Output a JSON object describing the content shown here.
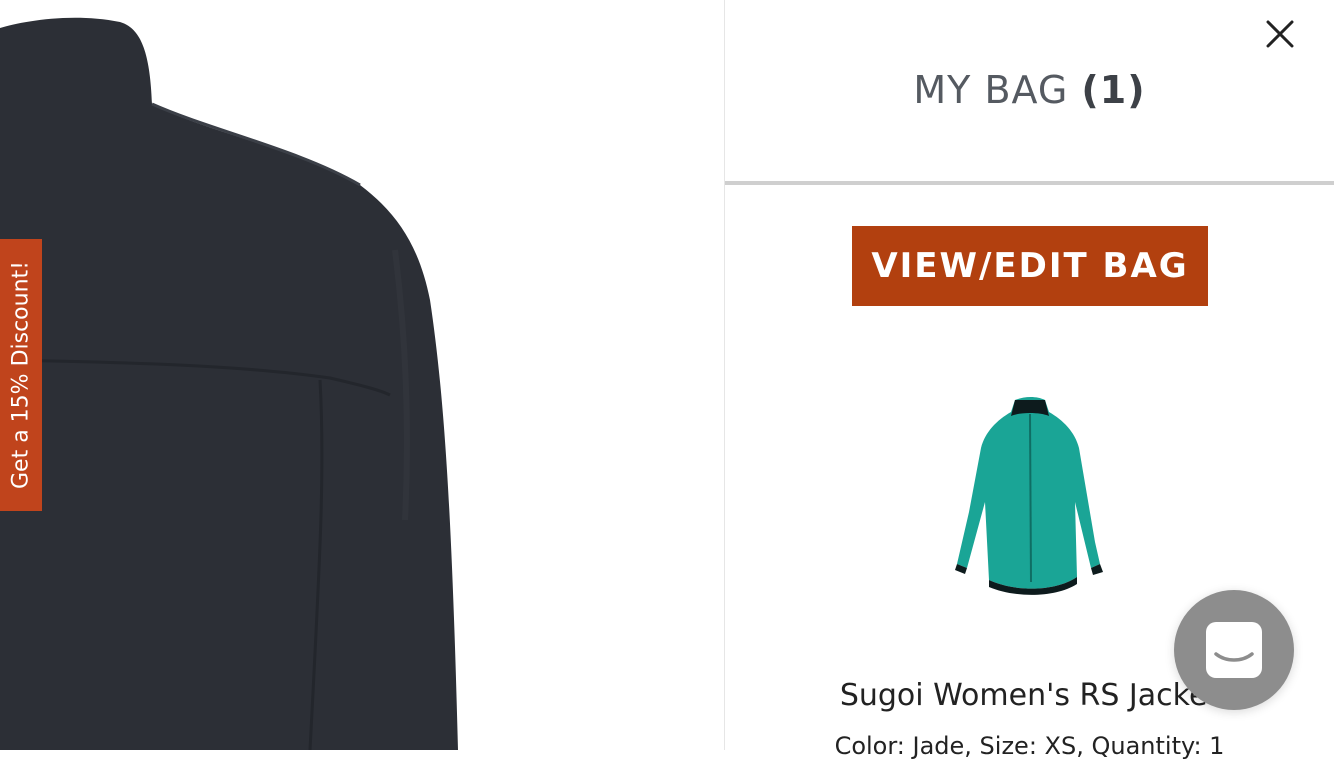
{
  "discount_tab": {
    "label": "Get a 15% Discount!"
  },
  "bag": {
    "title": "MY BAG",
    "count": "(1)",
    "view_edit_label": "VIEW/EDIT BAG",
    "item": {
      "name": "Sugoi Women's RS Jacket",
      "meta": "Color: Jade, Size: XS, Quantity: 1"
    }
  },
  "icons": {
    "close": "close-icon",
    "chat": "chat-icon"
  },
  "colors": {
    "accent": "#b2400f",
    "discount_tab": "#c0441c",
    "jacket_dark": "#2c2f36",
    "jacket_jade": "#1aa596",
    "chat_bubble": "#8d8d8d"
  }
}
